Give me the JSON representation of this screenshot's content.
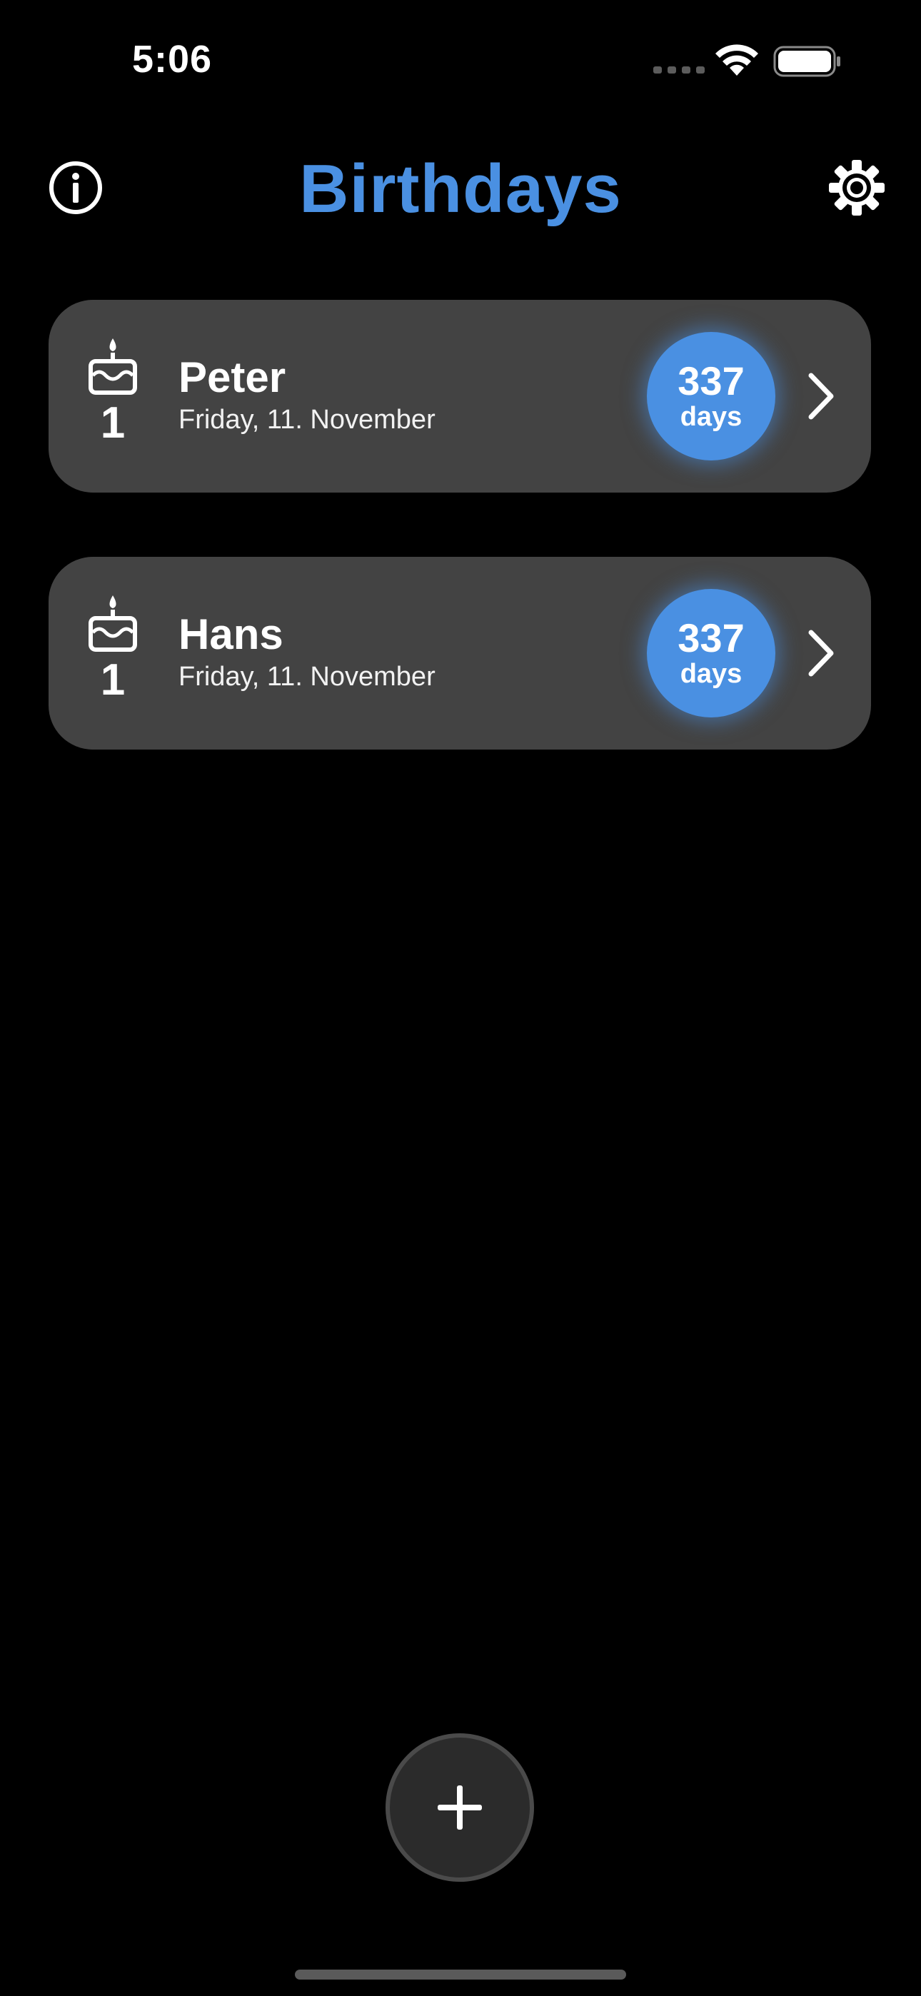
{
  "status_bar": {
    "time": "5:06",
    "icons": [
      "signal-dots-icon",
      "wifi-icon",
      "battery-icon"
    ]
  },
  "header": {
    "title": "Birthdays",
    "left_icon": "info-icon",
    "right_icon": "gear-icon"
  },
  "birthdays": [
    {
      "age": "1",
      "name": "Peter",
      "date": "Friday, 11. November",
      "days_count": "337",
      "days_unit": "days",
      "icon": "birthday-cake-icon"
    },
    {
      "age": "1",
      "name": "Hans",
      "date": "Friday, 11. November",
      "days_count": "337",
      "days_unit": "days",
      "icon": "birthday-cake-icon"
    }
  ],
  "add_button": {
    "icon": "plus-icon"
  },
  "colors": {
    "background": "#000000",
    "accent": "#4a90e2",
    "card": "#434343",
    "text": "#ffffff"
  }
}
